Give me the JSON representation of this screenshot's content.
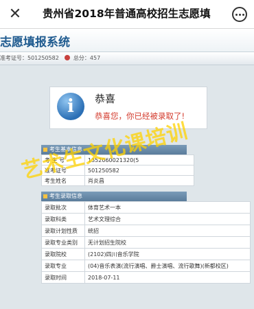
{
  "nav": {
    "close_label": "✕",
    "title": "贵州省2018年普通高校招生志愿填"
  },
  "header": {
    "system_title": "志愿填报系统",
    "exam_number": "准考证号：501250582",
    "score": "总分：457"
  },
  "message": {
    "title": "恭喜",
    "text": "恭喜您，你已经被录取了!"
  },
  "basic": {
    "heading": "考生基本信息",
    "rows": [
      {
        "label": "考 生 号",
        "value": "1352060021320(5"
      },
      {
        "label": "准考证号",
        "value": "501250582"
      },
      {
        "label": "考生姓名",
        "value": "肖炎昌"
      }
    ]
  },
  "admission": {
    "heading": "考生录取信息",
    "rows": [
      {
        "label": "录取批次",
        "value": "体育艺术一本"
      },
      {
        "label": "录取科类",
        "value": "艺术文理综合"
      },
      {
        "label": "录取计划性质",
        "value": "统招"
      },
      {
        "label": "录取专业类别",
        "value": "无计划招生院校"
      },
      {
        "label": "录取院校",
        "value": "(2102)四川音乐学院"
      },
      {
        "label": "录取专业",
        "value": "(04)音乐表演(流行演唱、爵士演唱、流行歌舞)(新都校区)"
      },
      {
        "label": "录取时间",
        "value": "2018-07-11"
      }
    ]
  },
  "watermark": "艺术生文化课培训",
  "colors": {
    "accent": "#1e5a8f",
    "success_text": "#d33a2c",
    "watermark": "#ffd200"
  }
}
